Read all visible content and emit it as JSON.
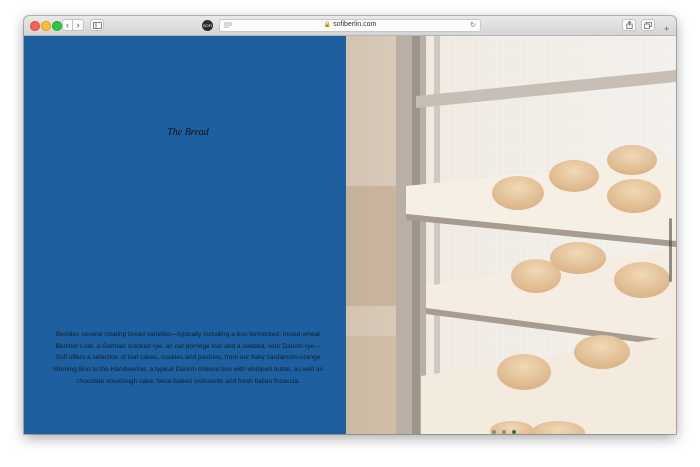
{
  "browser": {
    "url": "sofiberlin.com",
    "nav_back_icon": "‹",
    "nav_fwd_icon": "›",
    "reload_icon": "↻",
    "new_tab_icon": "+",
    "favicon_text": "SOFI"
  },
  "page": {
    "heading": "The Bread",
    "description": "Besides several rotating bread varieties—typically including a box-fermented, mixed-wheat Berliner Loaf, a German cracked rye, an oat porridge loaf and a seeded, sour Danish rye—Sofi offers a selection of loaf cakes, cookies and pastries, from our flaky cardamom-orange Morning Bun to the Handwerker, a typical Danish cheese bun with whipped butter, as well as chocolate sourdough cake, twice-baked croissants and fresh Italian focaccia.",
    "background_color": "#1d5f9f",
    "slide_count": 3,
    "active_slide": 3
  },
  "icons": {
    "share": "share-icon",
    "tabs": "tabs-icon",
    "sidebar": "sidebar-icon",
    "lock": "lock-icon"
  }
}
